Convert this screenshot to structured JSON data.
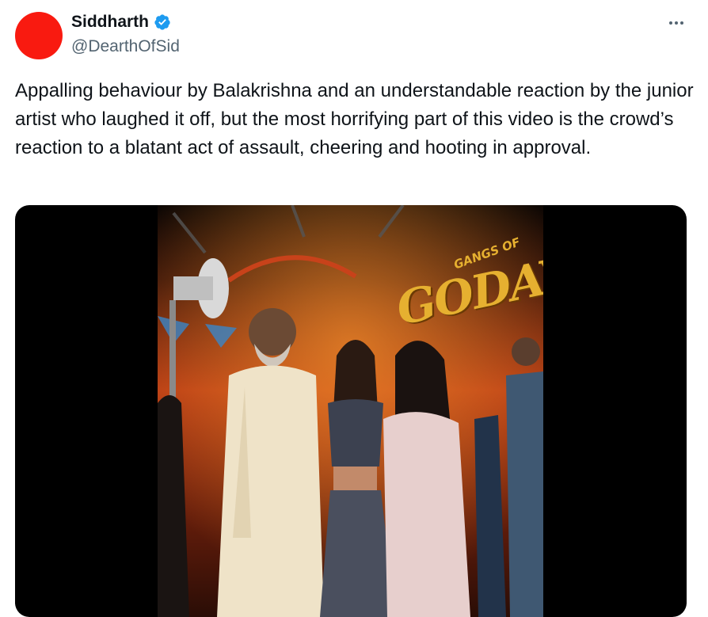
{
  "author": {
    "display_name": "Siddharth",
    "handle": "@DearthOfSid",
    "verified": true,
    "avatar_color": "#f91a10",
    "verified_color": "#1d9bf0"
  },
  "menu": {
    "icon": "more-horizontal-icon"
  },
  "tweet": {
    "text": "Appalling behaviour by Balakrishna and an understandable reaction by the junior artist who laughed it off, but the most horrifying part of this video is the crowd’s reaction to a blatant act of assault, cheering and hooting in approval."
  },
  "media": {
    "type": "video",
    "backdrop_title": "GODAVA",
    "backdrop_subtitle": "GANGS OF"
  }
}
